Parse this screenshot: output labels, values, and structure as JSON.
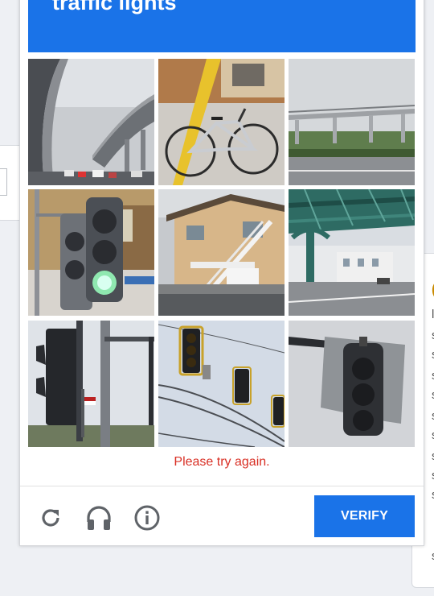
{
  "challenge": {
    "header_text": "traffic lights",
    "tiles": [
      {
        "subject": "highway-overpass"
      },
      {
        "subject": "bicycle"
      },
      {
        "subject": "pedestrian-bridge"
      },
      {
        "subject": "traffic-light-green"
      },
      {
        "subject": "houses-with-stairs"
      },
      {
        "subject": "elevated-structure"
      },
      {
        "subject": "traffic-light-back"
      },
      {
        "subject": "traffic-lights-on-wire"
      },
      {
        "subject": "traffic-light-underside"
      }
    ],
    "error_message": "Please try again.",
    "verify_label": "VERIFY"
  },
  "footer": {
    "icons": [
      "reload-icon",
      "headphones-icon",
      "info-icon"
    ]
  },
  "colors": {
    "accent": "#1a73e8",
    "error": "#d93025"
  }
}
